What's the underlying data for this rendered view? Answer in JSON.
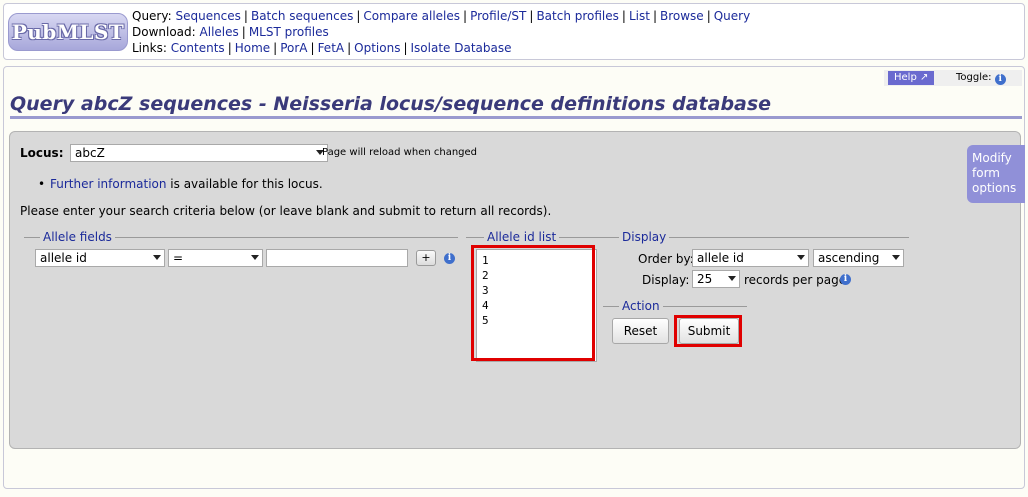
{
  "header": {
    "logo_text": "PubMLST",
    "query_label": "Query:",
    "query_links": [
      "Sequences",
      "Batch sequences",
      "Compare alleles",
      "Profile/ST",
      "Batch profiles",
      "List",
      "Browse",
      "Query"
    ],
    "download_label": "Download:",
    "download_links": [
      "Alleles",
      "MLST profiles"
    ],
    "links_label": "Links:",
    "links": [
      "Contents",
      "Home",
      "PorA",
      "FetA",
      "Options",
      "Isolate Database"
    ]
  },
  "topbar": {
    "help_label": "Help",
    "toggle_label": "Toggle:",
    "info_glyph": "i"
  },
  "page_title": "Query abcZ sequences - Neisseria locus/sequence definitions database",
  "locus": {
    "label": "Locus:",
    "selected": "abcZ",
    "note": "Page will reload when changed"
  },
  "further_info": {
    "link": "Further information",
    "text": " is available for this locus."
  },
  "instructions": "Please enter your search criteria below (or leave blank and submit to return all records).",
  "allele_fields": {
    "legend": "Allele fields",
    "field_selected": "allele id",
    "operator_selected": "=",
    "value": "",
    "plus_label": "+"
  },
  "allele_id_list": {
    "legend": "Allele id list",
    "values": [
      "1",
      "2",
      "3",
      "4",
      "5"
    ]
  },
  "display": {
    "legend": "Display",
    "order_by_label": "Order by:",
    "order_by_selected": "allele id",
    "direction_selected": "ascending",
    "display_label": "Display:",
    "per_page_selected": "25",
    "per_page_suffix": "records per page"
  },
  "action": {
    "legend": "Action",
    "reset_label": "Reset",
    "submit_label": "Submit"
  },
  "modify_form": {
    "label": "Modify form options"
  },
  "colors": {
    "link": "#1b2a9a",
    "title": "#3a3a7a",
    "accent": "#9a9acf",
    "highlight": "#e00000"
  }
}
